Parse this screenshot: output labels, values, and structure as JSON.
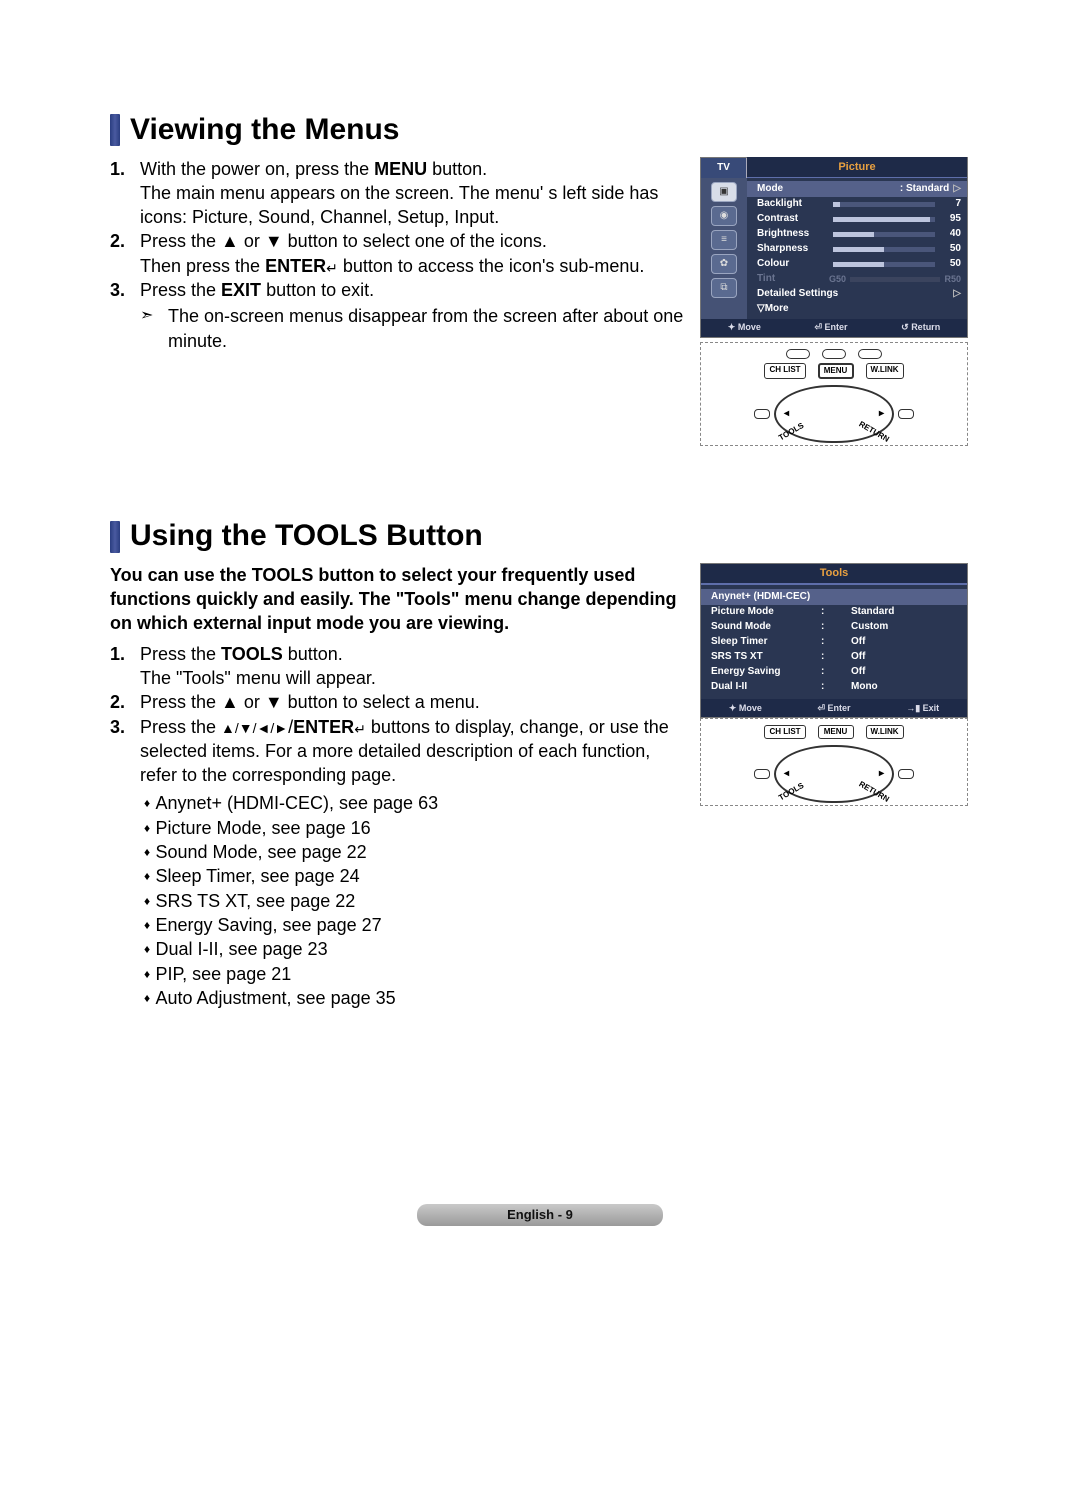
{
  "section1": {
    "title": "Viewing the Menus",
    "steps": [
      {
        "num": "1.",
        "lines": [
          "With the power on, press the MENU button.",
          "The main menu appears on the screen. The menu' s left side has icons: Picture, Sound, Channel, Setup, Input."
        ],
        "bold": [
          "MENU"
        ]
      },
      {
        "num": "2.",
        "lines": [
          "Press the ▲ or ▼ button to select one of the icons.",
          "Then press the ENTER↵ button to access the icon's sub-menu."
        ],
        "bold": [
          "ENTER"
        ]
      },
      {
        "num": "3.",
        "lines": [
          "Press the EXIT button to exit."
        ],
        "bold": [
          "EXIT"
        ],
        "note": "The on-screen menus disappear from the screen after about one minute."
      }
    ],
    "osd": {
      "tv": "TV",
      "title": "Picture",
      "rows": [
        {
          "label": "Mode",
          "value": ": Standard",
          "selected": true,
          "triangle": true
        },
        {
          "label": "Backlight",
          "bar": 7,
          "max": 100,
          "value": "7"
        },
        {
          "label": "Contrast",
          "bar": 95,
          "max": 100,
          "value": "95"
        },
        {
          "label": "Brightness",
          "bar": 40,
          "max": 100,
          "value": "40"
        },
        {
          "label": "Sharpness",
          "bar": 50,
          "max": 100,
          "value": "50"
        },
        {
          "label": "Colour",
          "bar": 50,
          "max": 100,
          "value": "50"
        },
        {
          "label": "Tint",
          "muted": true,
          "leftlbl": "G50",
          "rightlbl": "R50"
        },
        {
          "label": "Detailed Settings",
          "triangle": true
        },
        {
          "label": "▽More"
        }
      ],
      "footer": {
        "move": "Move",
        "enter": "Enter",
        "return": "Return"
      }
    },
    "remote": {
      "top_pills": 3,
      "buttons": [
        "CH LIST",
        "MENU",
        "W.LINK"
      ],
      "tools": "TOOLS",
      "return": "RETURN"
    }
  },
  "section2": {
    "title": "Using the TOOLS Button",
    "intro": "You can use the TOOLS button to select your frequently used functions quickly and easily. The \"Tools\" menu change depending on which external input mode you are viewing.",
    "steps": [
      {
        "num": "1.",
        "lines": [
          "Press the TOOLS button.",
          "The \"Tools\" menu will appear."
        ],
        "bold": [
          "TOOLS"
        ]
      },
      {
        "num": "2.",
        "lines": [
          "Press the ▲ or ▼ button to select a menu."
        ]
      },
      {
        "num": "3.",
        "lines": [
          "Press the ▲/▼/◄/►/ENTER↵ buttons to display, change, or use the selected items. For a more detailed description of each function, refer to the corresponding page."
        ],
        "bold": [
          "ENTER"
        ]
      }
    ],
    "refs": [
      "Anynet+ (HDMI-CEC), see page 63",
      "Picture Mode, see page 16",
      "Sound Mode, see page 22",
      "Sleep Timer, see page 24",
      "SRS TS XT, see page 22",
      "Energy Saving, see page 27",
      "Dual I-II, see page 23",
      "PIP, see page 21",
      "Auto Adjustment, see page 35"
    ],
    "tools_osd": {
      "title": "Tools",
      "rows": [
        {
          "label": "Anynet+ (HDMI-CEC)",
          "selected": true
        },
        {
          "label": "Picture Mode",
          "value": "Standard"
        },
        {
          "label": "Sound Mode",
          "value": "Custom"
        },
        {
          "label": "Sleep Timer",
          "value": "Off"
        },
        {
          "label": "SRS TS XT",
          "value": "Off"
        },
        {
          "label": "Energy Saving",
          "value": "Off"
        },
        {
          "label": "Dual I-II",
          "value": "Mono"
        }
      ],
      "footer": {
        "move": "Move",
        "enter": "Enter",
        "exit": "Exit"
      }
    },
    "remote": {
      "buttons": [
        "CH LIST",
        "MENU",
        "W.LINK"
      ],
      "tools": "TOOLS",
      "return": "RETURN"
    }
  },
  "footer": {
    "lang": "English",
    "sep": " - ",
    "page": "9"
  }
}
